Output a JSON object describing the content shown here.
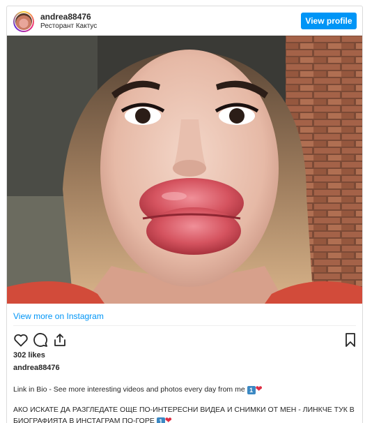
{
  "header": {
    "username": "andrea88476",
    "location": "Ресторант Кактус",
    "view_profile_label": "View profile"
  },
  "post": {
    "view_more_label": "View more on Instagram",
    "likes": "302 likes",
    "owner": "andrea88476",
    "caption_line_1": "Link in Bio - See more interesting videos and photos every day from me",
    "caption_line_2": "АКО ИСКАТЕ ДА РАЗГЛЕДАТЕ ОЩЕ ПО-ИНТЕРЕСНИ ВИДЕА И СНИМКИ ОТ МЕН - ЛИНКЧЕ ТУК В БИОГРАФИЯТА В ИНСТАГРАМ ПО-ГОРЕ",
    "emoji_number": "1",
    "emoji_heart": "❤"
  },
  "icons": [
    "heart-icon",
    "comment-icon",
    "share-icon",
    "bookmark-icon"
  ],
  "colors": {
    "accent": "#0095f6",
    "text": "#262626",
    "border": "#dbdbdb"
  }
}
